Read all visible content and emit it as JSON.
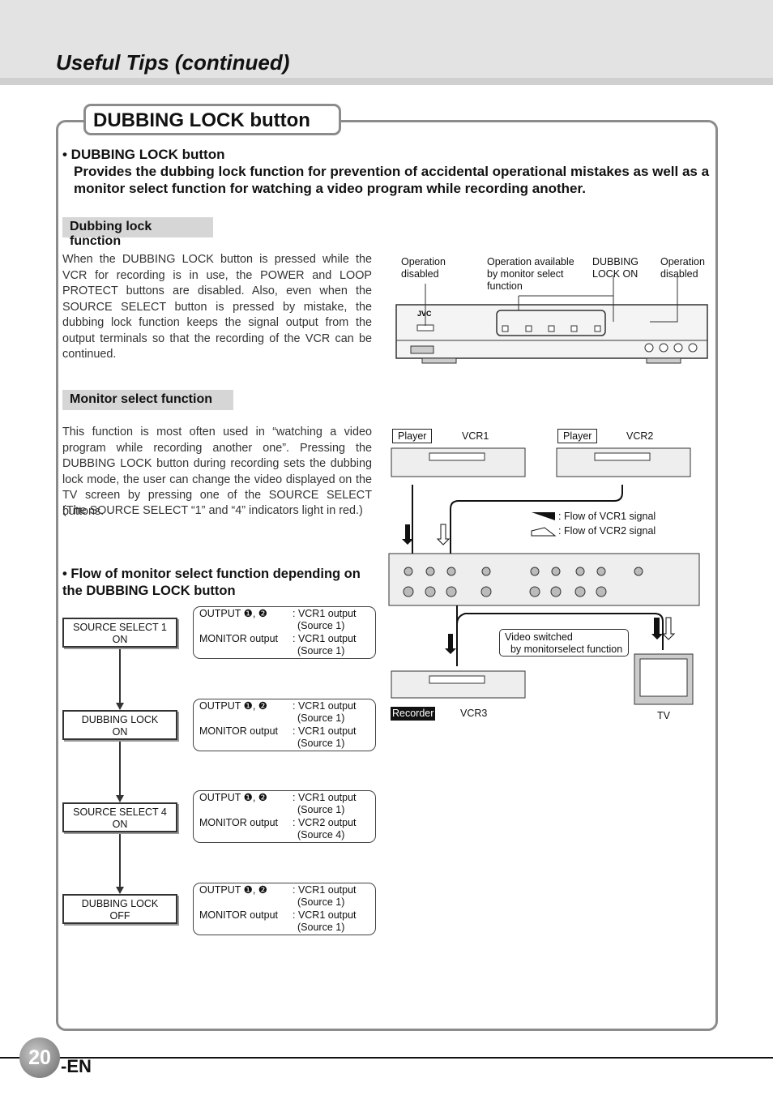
{
  "header": {
    "title": "Useful Tips (continued)"
  },
  "section": {
    "title": "DUBBING LOCK button"
  },
  "intro": {
    "heading": "• DUBBING LOCK button",
    "text": "Provides the dubbing lock function for prevention of accidental operational mistakes as well as a monitor select function for watching a video program while recording another."
  },
  "dubbing_lock": {
    "label": "Dubbing lock function",
    "text": "When the DUBBING LOCK button is pressed while the VCR for recording is in use, the POWER and LOOP PROTECT buttons are disabled. Also, even when the SOURCE SELECT button is pressed by mistake, the dubbing lock function keeps the signal output from the output terminals so that the recording of the VCR can be continued.",
    "callouts": [
      "Operation disabled",
      "Operation available by monitor select function",
      "DUBBING LOCK ON",
      "Operation disabled"
    ]
  },
  "monitor_select": {
    "label": "Monitor select function",
    "text": "This function is most often used in “watching a video program while recording another one”. Pressing the DUBBING LOCK button during recording sets the dubbing lock mode, the user can change the video displayed on the TV screen by pressing one of the SOURCE SELECT buttons.",
    "note": "(The SOURCE SELECT “1” and “4” indicators light in red.)"
  },
  "flow": {
    "heading": "• Flow of monitor select function depending on the DUBBING LOCK button",
    "steps": [
      {
        "state": "SOURCE SELECT 1\nON",
        "out_label": "OUTPUT ❶, ❷",
        "out_val": ": VCR1 output",
        "out_src": "(Source 1)",
        "mon_label": "MONITOR output",
        "mon_val": ": VCR1 output",
        "mon_src": "(Source 1)"
      },
      {
        "state": "DUBBING LOCK\nON",
        "out_label": "OUTPUT ❶, ❷",
        "out_val": ": VCR1 output",
        "out_src": "(Source 1)",
        "mon_label": "MONITOR output",
        "mon_val": ": VCR1 output",
        "mon_src": "(Source 1)"
      },
      {
        "state": "SOURCE SELECT 4\nON",
        "out_label": "OUTPUT ❶, ❷",
        "out_val": ": VCR1 output",
        "out_src": "(Source 1)",
        "mon_label": "MONITOR output",
        "mon_val": ": VCR2 output",
        "mon_src": "(Source 4)"
      },
      {
        "state": "DUBBING LOCK\nOFF",
        "out_label": "OUTPUT ❶, ❷",
        "out_val": ": VCR1 output",
        "out_src": "(Source 1)",
        "mon_label": "MONITOR output",
        "mon_val": ": VCR1 output",
        "mon_src": "(Source 1)"
      }
    ]
  },
  "diagram": {
    "player1": "Player",
    "vcr1": "VCR1",
    "player2": "Player",
    "vcr2": "VCR2",
    "legend1": ": Flow of VCR1 signal",
    "legend2": ": Flow of VCR2 signal",
    "switched": "Video switched\n  by monitorselect function",
    "recorder": "Recorder",
    "vcr3": "VCR3",
    "tv": "TV"
  },
  "footer": {
    "page": "20",
    "suffix": "-EN"
  }
}
